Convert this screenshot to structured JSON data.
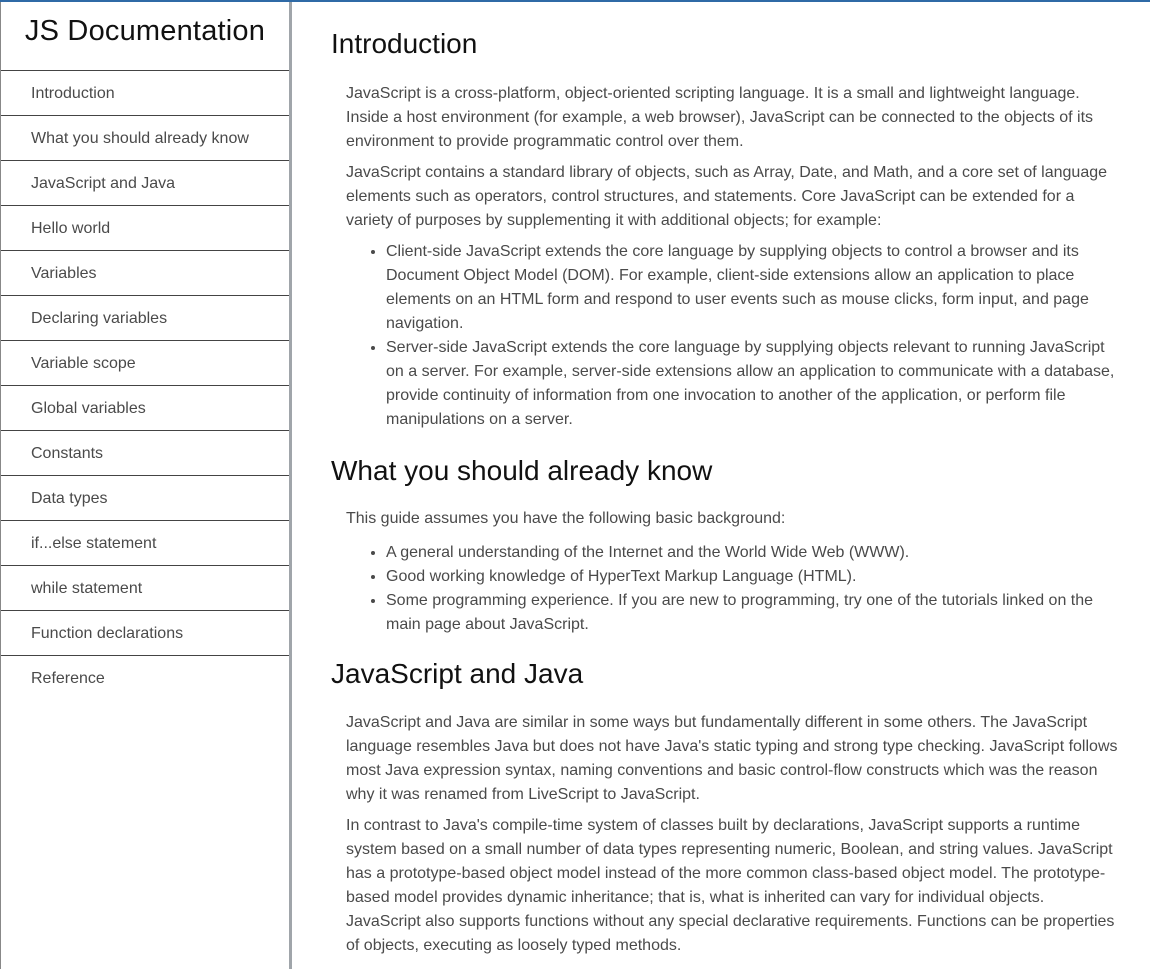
{
  "sidebar": {
    "title": "JS Documentation",
    "items": [
      {
        "label": "Introduction"
      },
      {
        "label": "What you should already know"
      },
      {
        "label": "JavaScript and Java"
      },
      {
        "label": "Hello world"
      },
      {
        "label": "Variables"
      },
      {
        "label": "Declaring variables"
      },
      {
        "label": "Variable scope"
      },
      {
        "label": "Global variables"
      },
      {
        "label": "Constants"
      },
      {
        "label": "Data types"
      },
      {
        "label": "if...else statement"
      },
      {
        "label": "while statement"
      },
      {
        "label": "Function declarations"
      },
      {
        "label": "Reference"
      }
    ]
  },
  "main": {
    "sections": [
      {
        "heading": "Introduction",
        "paragraphs": [
          "JavaScript is a cross-platform, object-oriented scripting language. It is a small and lightweight language. Inside a host environment (for example, a web browser), JavaScript can be connected to the objects of its environment to provide programmatic control over them.",
          "JavaScript contains a standard library of objects, such as Array, Date, and Math, and a core set of language elements such as operators, control structures, and statements. Core JavaScript can be extended for a variety of purposes by supplementing it with additional objects; for example:"
        ],
        "list": [
          "Client-side JavaScript extends the core language by supplying objects to control a browser and its Document Object Model (DOM). For example, client-side extensions allow an application to place elements on an HTML form and respond to user events such as mouse clicks, form input, and page navigation.",
          "Server-side JavaScript extends the core language by supplying objects relevant to running JavaScript on a server. For example, server-side extensions allow an application to communicate with a database, provide continuity of information from one invocation to another of the application, or perform file manipulations on a server."
        ]
      },
      {
        "heading": "What you should already know",
        "paragraphs": [
          "This guide assumes you have the following basic background:"
        ],
        "list": [
          "A general understanding of the Internet and the World Wide Web (WWW).",
          "Good working knowledge of HyperText Markup Language (HTML).",
          "Some programming experience. If you are new to programming, try one of the tutorials linked on the main page about JavaScript."
        ]
      },
      {
        "heading": "JavaScript and Java",
        "paragraphs": [
          "JavaScript and Java are similar in some ways but fundamentally different in some others. The JavaScript language resembles Java but does not have Java's static typing and strong type checking. JavaScript follows most Java expression syntax, naming conventions and basic control-flow constructs which was the reason why it was renamed from LiveScript to JavaScript.",
          "In contrast to Java's compile-time system of classes built by declarations, JavaScript supports a runtime system based on a small number of data types representing numeric, Boolean, and string values. JavaScript has a prototype-based object model instead of the more common class-based object model. The prototype-based model provides dynamic inheritance; that is, what is inherited can vary for individual objects. JavaScript also supports functions without any special declarative requirements. Functions can be properties of objects, executing as loosely typed methods."
        ]
      }
    ]
  }
}
